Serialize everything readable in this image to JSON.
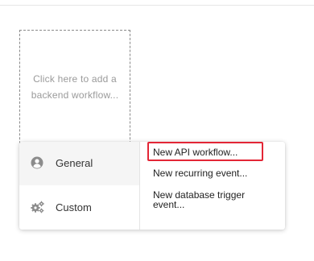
{
  "placeholder": {
    "text": "Click here to add a backend workflow..."
  },
  "menu": {
    "categories": [
      {
        "label": "General",
        "icon": "user-circle-icon",
        "active": true
      },
      {
        "label": "Custom",
        "icon": "gears-icon",
        "active": false
      }
    ],
    "options": [
      {
        "label": "New API workflow...",
        "highlighted": true
      },
      {
        "label": "New recurring event..."
      },
      {
        "label": "New database trigger event..."
      }
    ]
  },
  "colors": {
    "highlight_border": "#e32636",
    "active_category_bg": "#f5f5f5",
    "placeholder_text": "#9a9a9a"
  }
}
